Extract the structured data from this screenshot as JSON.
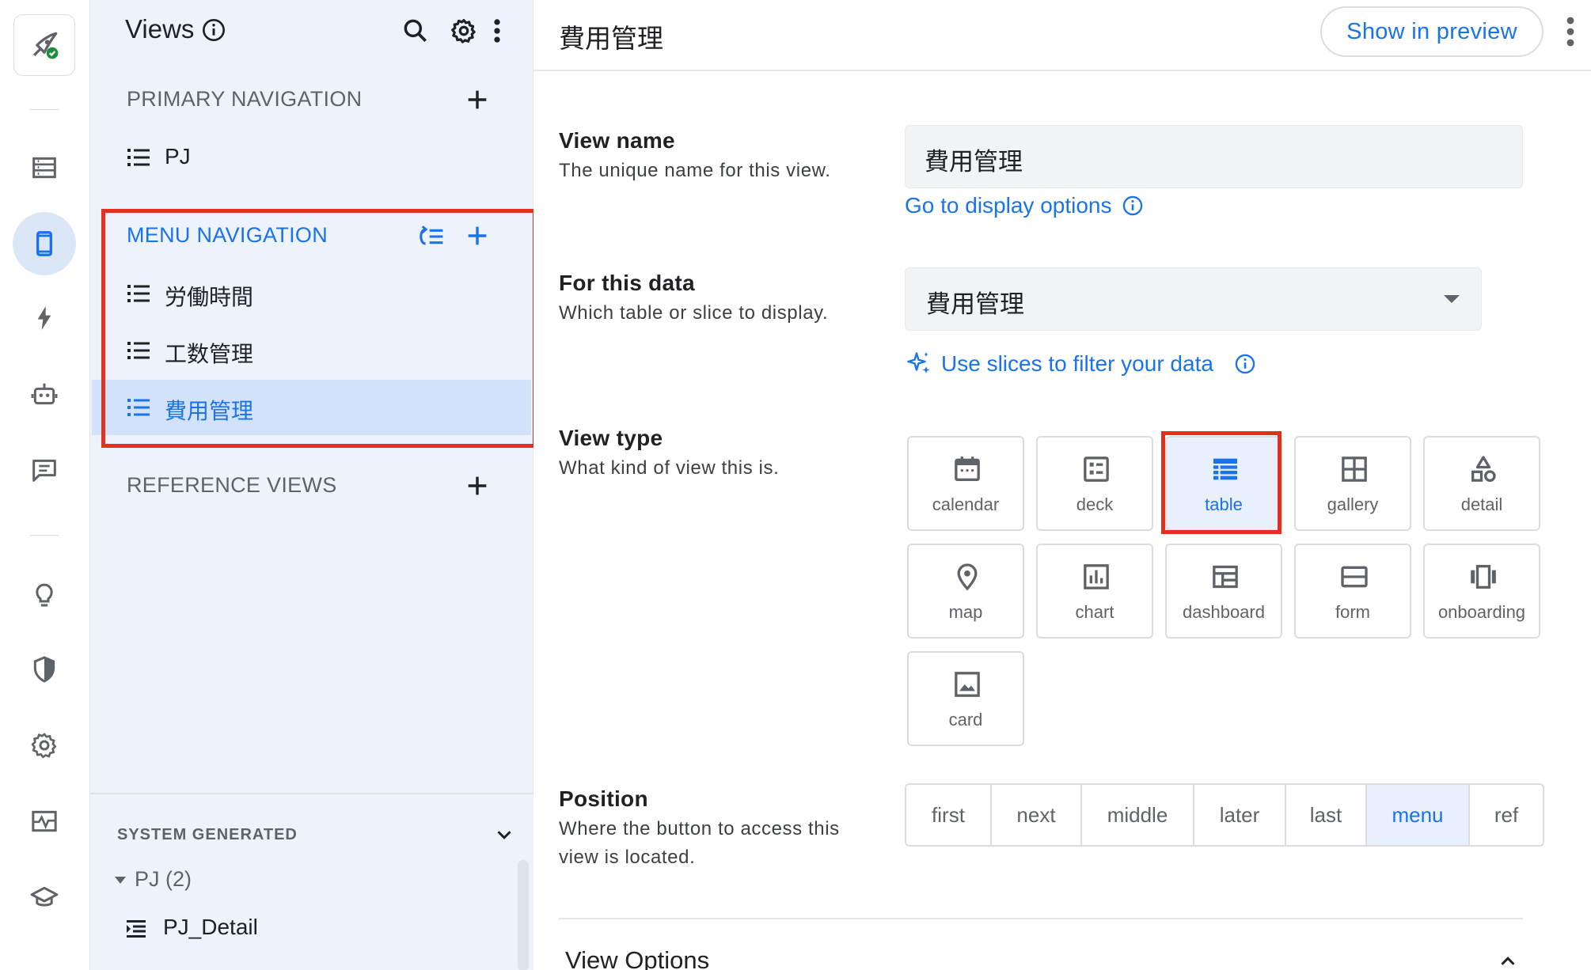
{
  "rail": {
    "items": [
      "logo-rocket",
      "data-icon",
      "phone-views-icon",
      "automation-bolt-icon",
      "bot-icon",
      "chat-icon",
      "lightbulb-icon",
      "security-shield-icon",
      "settings-gear-icon",
      "monitor-pulse-icon",
      "learn-cap-icon"
    ],
    "active": "phone-views-icon"
  },
  "panel": {
    "title": "Views",
    "primary_label": "PRIMARY NAVIGATION",
    "primary_items": [
      {
        "label": "PJ"
      }
    ],
    "menu_label": "MENU NAVIGATION",
    "menu_items": [
      {
        "label": "労働時間"
      },
      {
        "label": "工数管理"
      },
      {
        "label": "費用管理"
      }
    ],
    "reference_label": "REFERENCE VIEWS",
    "system_label": "SYSTEM GENERATED",
    "system_tree": {
      "label": "PJ (2)",
      "child": "PJ_Detail"
    }
  },
  "main": {
    "title": "費用管理",
    "preview_button": "Show in preview",
    "view_name": {
      "title": "View name",
      "desc": "The unique name for this view.",
      "value": "費用管理",
      "link": "Go to display options"
    },
    "for_data": {
      "title": "For this data",
      "desc": "Which table or slice to display.",
      "value": "費用管理",
      "link": "Use slices to filter your data"
    },
    "view_type": {
      "title": "View type",
      "desc": "What kind of view this is.",
      "options": [
        "calendar",
        "deck",
        "table",
        "gallery",
        "detail",
        "map",
        "chart",
        "dashboard",
        "form",
        "onboarding",
        "card"
      ],
      "selected": "table"
    },
    "position": {
      "title": "Position",
      "desc": "Where the button to access this view is located.",
      "options": [
        "first",
        "next",
        "middle",
        "later",
        "last",
        "menu",
        "ref"
      ],
      "selected": "menu"
    },
    "view_options_title": "View Options"
  },
  "colors": {
    "accent": "#1a73e8",
    "highlight_box": "#e0301e",
    "panel_bg": "#eef2fb",
    "selected_bg": "#d3e2fb"
  }
}
